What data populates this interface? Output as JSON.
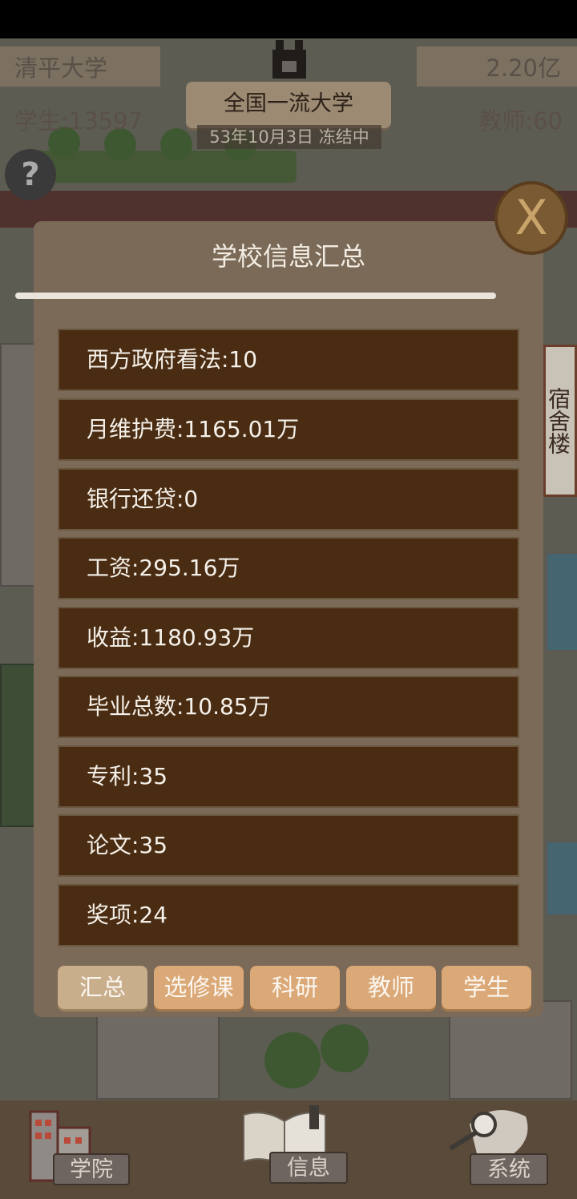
{
  "hud": {
    "school_name": "清平大学",
    "funds": "2.20亿",
    "students": "学生:13597",
    "teachers": "教师:60",
    "rank_title": "全国一流大学",
    "date_status": "53年10月3日 冻结中"
  },
  "map": {
    "dorm_label": "宿舍楼"
  },
  "panel": {
    "title": "学校信息汇总",
    "rows": [
      "西方政府看法:10",
      "月维护费:1165.01万",
      "银行还贷:0",
      "工资:295.16万",
      "收益:1180.93万",
      "毕业总数:10.85万",
      "专利:35",
      "论文:35",
      "奖项:24"
    ],
    "tabs": [
      "汇总",
      "选修课",
      "科研",
      "教师",
      "学生"
    ],
    "active_tab": "汇总"
  },
  "icons": {
    "help": "?",
    "close": "X"
  },
  "bottom_nav": {
    "items": [
      "学院",
      "信息",
      "系统"
    ]
  }
}
